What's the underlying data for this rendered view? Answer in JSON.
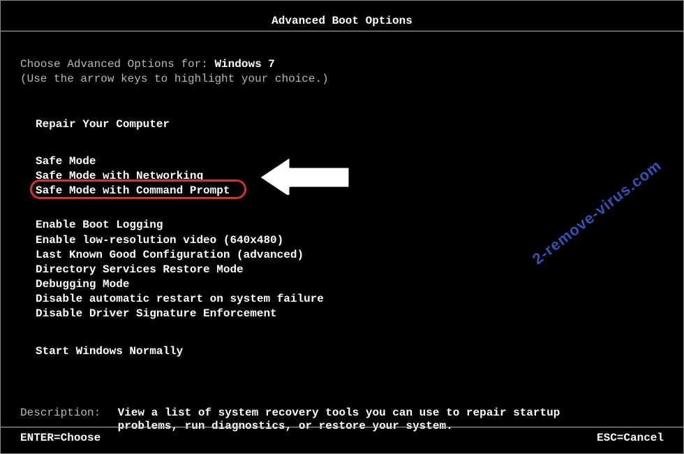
{
  "title": "Advanced Boot Options",
  "prompt": {
    "prefix": "Choose Advanced Options for: ",
    "os": "Windows 7",
    "hint": "(Use the arrow keys to highlight your choice.)"
  },
  "menu": {
    "group1": [
      "Repair Your Computer"
    ],
    "group2": [
      "Safe Mode",
      "Safe Mode with Networking",
      "Safe Mode with Command Prompt"
    ],
    "group3": [
      "Enable Boot Logging",
      "Enable low-resolution video (640x480)",
      "Last Known Good Configuration (advanced)",
      "Directory Services Restore Mode",
      "Debugging Mode",
      "Disable automatic restart on system failure",
      "Disable Driver Signature Enforcement"
    ],
    "group4": [
      "Start Windows Normally"
    ],
    "selected_index_group2": 2
  },
  "description": {
    "label": "Description:",
    "text": "View a list of system recovery tools you can use to repair startup problems, run diagnostics, or restore your system."
  },
  "footer": {
    "left": "ENTER=Choose",
    "right": "ESC=Cancel"
  },
  "watermark": "2-remove-virus.com"
}
